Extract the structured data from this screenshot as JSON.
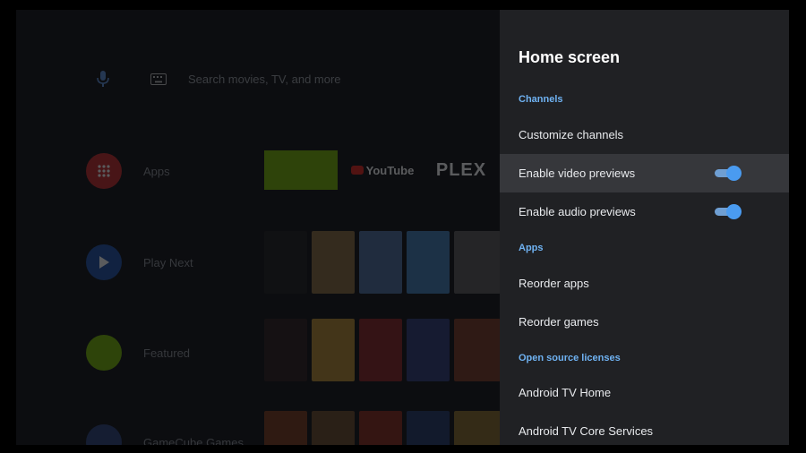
{
  "home": {
    "search_placeholder": "Search movies, TV, and more",
    "rows": [
      {
        "label": "Apps"
      },
      {
        "label": "Play Next"
      },
      {
        "label": "Featured"
      },
      {
        "label": "GameCube Games"
      }
    ],
    "apps": [
      {
        "name": "youtube-app",
        "label": "YouTube"
      },
      {
        "name": "plex-app",
        "label": "PLEX"
      }
    ]
  },
  "panel": {
    "title": "Home screen",
    "sections": {
      "channels": "Channels",
      "apps": "Apps",
      "licenses": "Open source licenses"
    },
    "items": {
      "customize_channels": "Customize channels",
      "enable_video_previews": "Enable video previews",
      "enable_audio_previews": "Enable audio previews",
      "reorder_apps": "Reorder apps",
      "reorder_games": "Reorder games",
      "android_tv_home": "Android TV Home",
      "android_tv_core_services": "Android TV Core Services"
    },
    "toggles": {
      "video_previews": true,
      "audio_previews": true
    }
  },
  "colors": {
    "accent": "#4a9bf0",
    "section_text": "#6fb2f2",
    "panel_bg": "#202124",
    "focused_bg": "#36373b"
  }
}
